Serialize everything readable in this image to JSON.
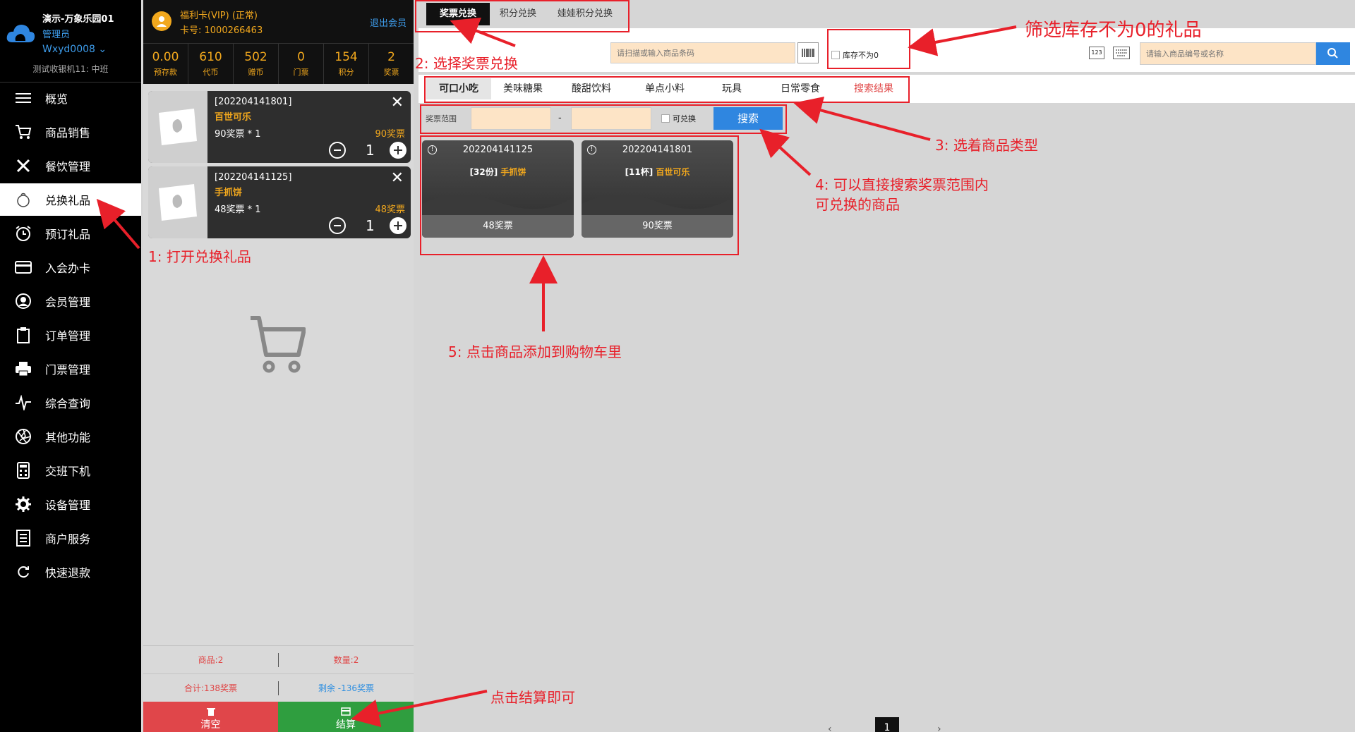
{
  "sidebar": {
    "store": "演示-万象乐园01",
    "role": "管理员",
    "user": "Wxyd0008",
    "shift": "测试收银机11: 中班",
    "items": [
      {
        "label": "概览",
        "icon": "menu-icon"
      },
      {
        "label": "商品销售",
        "icon": "cart-icon"
      },
      {
        "label": "餐饮管理",
        "icon": "fork-knife-icon"
      },
      {
        "label": "兑换礼品",
        "icon": "gift-icon"
      },
      {
        "label": "预订礼品",
        "icon": "alarm-icon"
      },
      {
        "label": "入会办卡",
        "icon": "card-icon"
      },
      {
        "label": "会员管理",
        "icon": "user-icon"
      },
      {
        "label": "订单管理",
        "icon": "clipboard-icon"
      },
      {
        "label": "门票管理",
        "icon": "printer-icon"
      },
      {
        "label": "综合查询",
        "icon": "pulse-icon"
      },
      {
        "label": "其他功能",
        "icon": "aperture-icon"
      },
      {
        "label": "交班下机",
        "icon": "calculator-icon"
      },
      {
        "label": "设备管理",
        "icon": "gear-icon"
      },
      {
        "label": "商户服务",
        "icon": "document-icon"
      },
      {
        "label": "快速退款",
        "icon": "refresh-icon"
      }
    ],
    "active_index": 3
  },
  "member": {
    "name": "福利卡(VIP) (正常)",
    "card": "卡号: 1000266463",
    "logout": "退出会员",
    "stats": [
      {
        "value": "0.00",
        "label": "预存款"
      },
      {
        "value": "610",
        "label": "代币"
      },
      {
        "value": "502",
        "label": "赠币"
      },
      {
        "value": "0",
        "label": "门票"
      },
      {
        "value": "154",
        "label": "积分"
      },
      {
        "value": "2",
        "label": "奖票"
      }
    ]
  },
  "cart": {
    "items": [
      {
        "code": "[202204141801]",
        "name": "百世可乐",
        "unit": "90奖票 * 1",
        "total": "90奖票",
        "qty": "1"
      },
      {
        "code": "[202204141125]",
        "name": "手抓饼",
        "unit": "48奖票 * 1",
        "total": "48奖票",
        "qty": "1"
      }
    ],
    "goods": "商品:2",
    "count": "数量:2",
    "sum": "合计:138奖票",
    "remain": "剩余 -136奖票",
    "clear": "清空",
    "checkout": "结算"
  },
  "tabs": [
    "奖票兑换",
    "积分兑换",
    "娃娃积分兑换"
  ],
  "toolbar": {
    "barcode_placeholder": "请扫描或输入商品条码",
    "stock_label": "库存不为0",
    "kb_num": "123",
    "search_placeholder": "请输入商品编号或名称"
  },
  "categories": [
    "可口小吃",
    "美味糖果",
    "酸甜饮料",
    "单点小料",
    "玩具",
    "日常零食",
    "搜索结果"
  ],
  "range": {
    "label": "奖票范围",
    "dash": "-",
    "redeemable": "可兑换",
    "search": "搜索"
  },
  "products": [
    {
      "code": "202204141125",
      "qty": "[32份]",
      "name": "手抓饼",
      "price": "48奖票"
    },
    {
      "code": "202204141801",
      "qty": "[11杯]",
      "name": "百世可乐",
      "price": "90奖票"
    }
  ],
  "pager": {
    "page": "1"
  },
  "annotations": {
    "a1": "1: 打开兑换礼品",
    "a2": "2: 选择奖票兑换",
    "a3": "3: 选着商品类型",
    "a4_line1": "4: 可以直接搜索奖票范围内",
    "a4_line2": "可兑换的商品",
    "a5": "5: 点击商品添加到购物车里",
    "a_stock": "筛选库存不为0的礼品",
    "a_checkout": "点击结算即可"
  },
  "colors": {
    "accent_orange": "#f2a81d",
    "annotation_red": "#e8202a",
    "primary_blue": "#2f86e0",
    "checkout_green": "#2f9e3f",
    "clear_red": "#e0464a"
  }
}
